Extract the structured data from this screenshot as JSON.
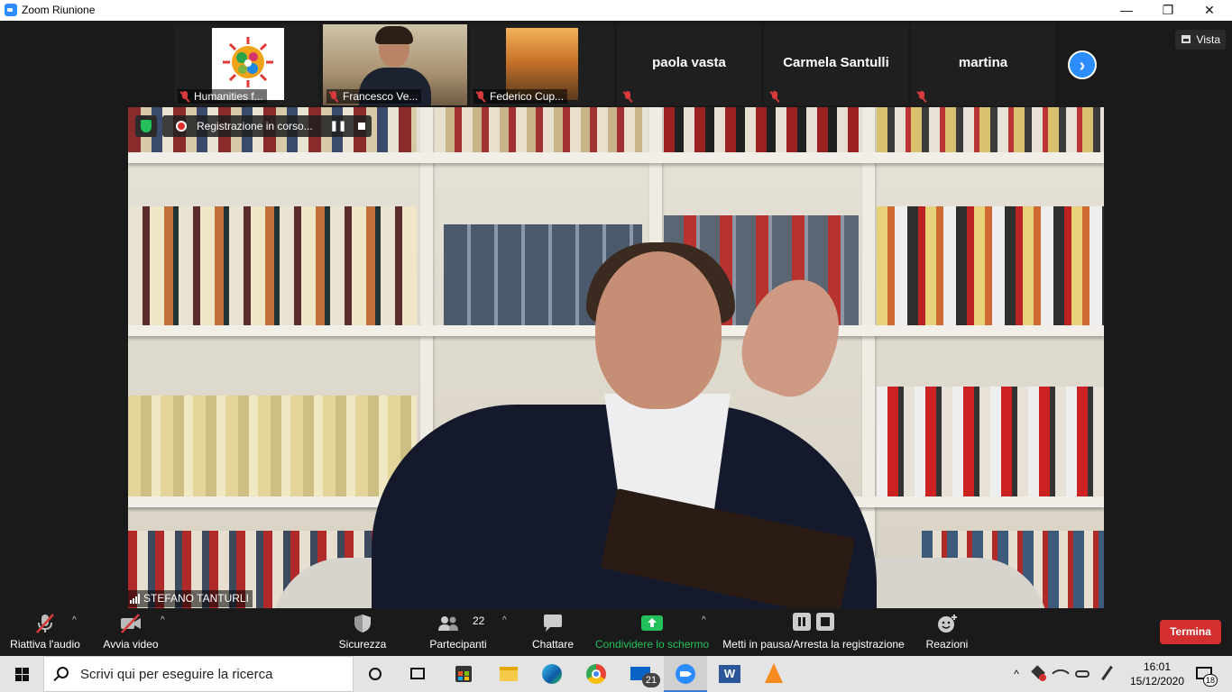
{
  "window": {
    "title": "Zoom Riunione",
    "minimize": "—",
    "maximize": "❐",
    "close": "✕"
  },
  "thumbnails": [
    {
      "name": "Humanities f...",
      "has_video": true
    },
    {
      "name": "Francesco Ve...",
      "has_video": true
    },
    {
      "name": "Federico Cup...",
      "has_video": true
    },
    {
      "name": "paola vasta",
      "has_video": false
    },
    {
      "name": "Carmela Santulli",
      "has_video": false
    },
    {
      "name": "martina",
      "has_video": false
    }
  ],
  "view_button": "Vista",
  "next_arrow": "›",
  "recording": {
    "status": "Registrazione in corso...",
    "pause": "❚❚"
  },
  "active_speaker": "STEFANO TANTURLI",
  "toolbar": {
    "audio": "Riattiva l'audio",
    "video": "Avvia video",
    "security": "Sicurezza",
    "participants": "Partecipanti",
    "participants_count": "22",
    "chat": "Chattare",
    "share": "Condividere lo schermo",
    "recording": "Metti in pausa/Arresta la registrazione",
    "reactions": "Reazioni",
    "end": "Termina",
    "caret": "^"
  },
  "taskbar": {
    "search_placeholder": "Scrivi qui per eseguire la ricerca",
    "mail_badge": "21",
    "time": "16:01",
    "date": "15/12/2020",
    "notifications": "18",
    "chevron": "^"
  },
  "colors": {
    "zoom_blue": "#2D8CFF",
    "share_green": "#23c05b",
    "end_red": "#d32f2f",
    "muted_red": "#d73b3b"
  }
}
